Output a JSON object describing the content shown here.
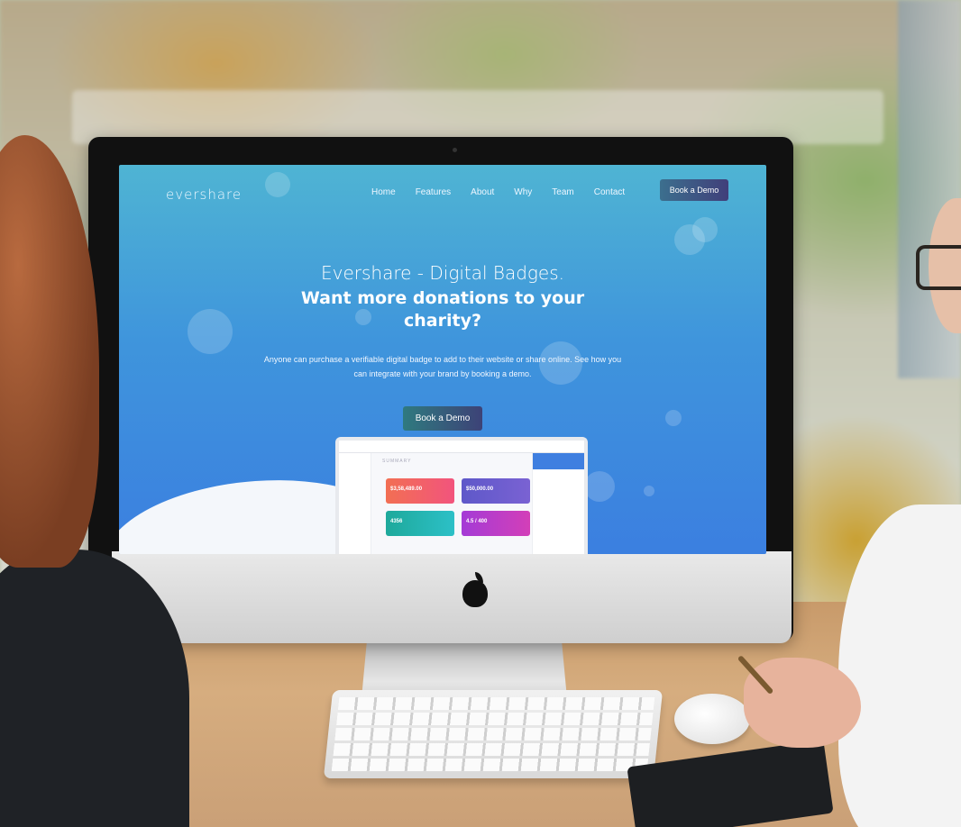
{
  "website": {
    "logo": "evershare",
    "nav": [
      "Home",
      "Features",
      "About",
      "Why",
      "Team",
      "Contact"
    ],
    "nav_cta": "Book a Demo",
    "hero": {
      "title": "Evershare - Digital Badges.",
      "subtitle": "Want more donations to your charity?",
      "body": "Anyone can purchase a verifiable digital badge to add to their website or share online. See how you can integrate with your brand by booking a demo.",
      "cta": "Book a Demo"
    },
    "dashboard": {
      "heading": "SUMMARY",
      "cards": [
        "$3,58,489.00",
        "$50,000.00",
        "4356",
        "4.5 / 400"
      ]
    }
  },
  "colors": {
    "gradient_top": "#4fb4d3",
    "gradient_bottom": "#3b7fe0",
    "cta": "#3d4277"
  }
}
